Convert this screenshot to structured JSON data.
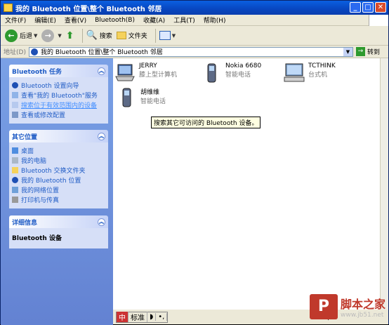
{
  "window": {
    "title": "我的 Bluetooth 位置\\整个 Bluetooth 邻居"
  },
  "menu": [
    "文件(F)",
    "编辑(E)",
    "查看(V)",
    "Bluetooth(B)",
    "收藏(A)",
    "工具(T)",
    "帮助(H)"
  ],
  "toolbar": {
    "back_label": "后退",
    "search_label": "搜索",
    "folders_label": "文件夹"
  },
  "address": {
    "label": "地址(D)",
    "value": "我的 Bluetooth 位置\\整个 Bluetooth 邻居",
    "go_label": "转到"
  },
  "tasks": {
    "title": "Bluetooth 任务",
    "items": [
      "Bluetooth 设置向导",
      "查看\"我的 Bluetooth\"服务",
      "搜索位于有效范围内的设备",
      "查看或修改配置"
    ]
  },
  "other_places": {
    "title": "其它位置",
    "items": [
      "桌面",
      "我的电脑",
      "Bluetooth 交换文件夹",
      "我的 Bluetooth 位置",
      "我的网络位置",
      "打印机与传真"
    ]
  },
  "details": {
    "title": "详细信息",
    "text": "Bluetooth 设备"
  },
  "devices": [
    {
      "name": "JERRY",
      "type": "膝上型计算机",
      "icon": "laptop-icon"
    },
    {
      "name": "Nokia 6680",
      "type": "智能电话",
      "icon": "phone-icon"
    },
    {
      "name": "TCTHINK",
      "type": "台式机",
      "icon": "desktop-icon"
    },
    {
      "name": "胡维维",
      "type": "智能电话",
      "icon": "phone-icon"
    }
  ],
  "tooltip": "搜索其它可访问的 Bluetooth 设备。",
  "status": {
    "ime": [
      "标准",
      "◗",
      "•,"
    ],
    "script": "Script"
  },
  "watermark": {
    "logo": "P",
    "text": "脚本之家",
    "url": "www.jb51.net"
  }
}
